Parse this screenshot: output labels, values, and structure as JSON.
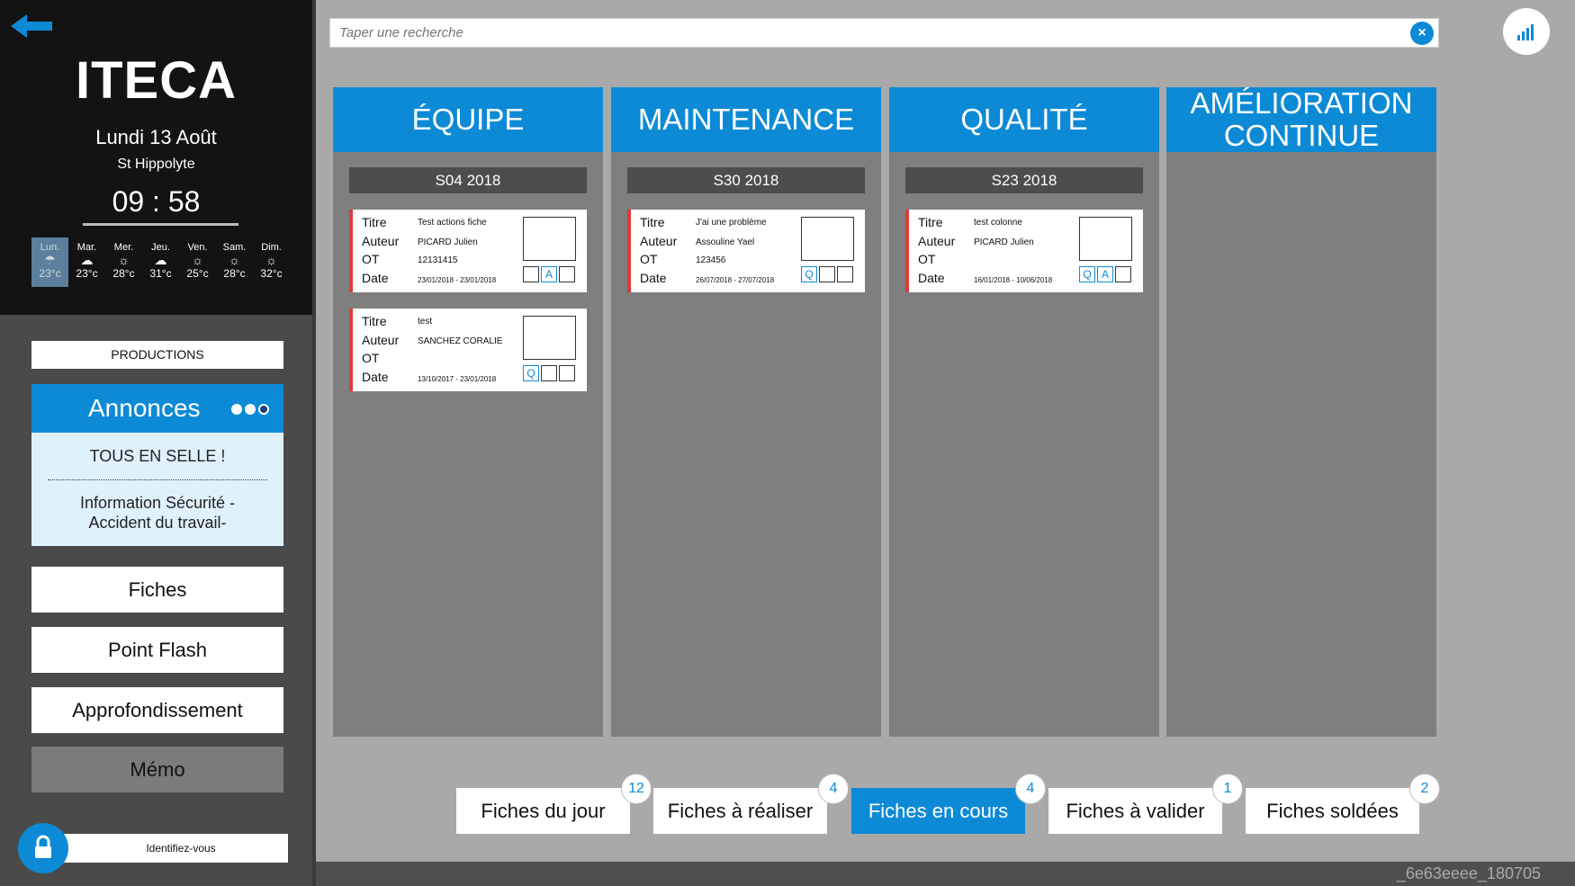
{
  "sidebar": {
    "logo": "ITECA",
    "date": "Lundi 13 Août",
    "location": "St Hippolyte",
    "clock": "09 : 58",
    "weather": [
      {
        "day": "Lun.",
        "icon": "rain-icon",
        "glyph": "☂",
        "temp": "23°c"
      },
      {
        "day": "Mar.",
        "icon": "cloud-icon",
        "glyph": "☁",
        "temp": "23°c"
      },
      {
        "day": "Mer.",
        "icon": "sun-icon",
        "glyph": "☼",
        "temp": "28°c"
      },
      {
        "day": "Jeu.",
        "icon": "cloud-icon",
        "glyph": "☁",
        "temp": "31°c"
      },
      {
        "day": "Ven.",
        "icon": "sun-icon",
        "glyph": "☼",
        "temp": "25°c"
      },
      {
        "day": "Sam.",
        "icon": "sun-icon",
        "glyph": "☼",
        "temp": "28°c"
      },
      {
        "day": "Dim.",
        "icon": "sun-icon",
        "glyph": "☼",
        "temp": "32°c"
      }
    ],
    "productions_label": "PRODUCTIONS",
    "annonces": {
      "title": "Annonces",
      "items": [
        "TOUS EN SELLE !",
        "Information Sécurité - Accident du travail-"
      ]
    },
    "buttons": {
      "fiches": "Fiches",
      "point_flash": "Point Flash",
      "approfondissement": "Approfondissement",
      "memo": "Mémo"
    },
    "login_placeholder": "Identifiez-vous"
  },
  "search": {
    "placeholder": "Taper une recherche"
  },
  "columns": [
    {
      "title": "ÉQUIPE",
      "week": "S04 2018",
      "cards": [
        {
          "titre": "Test actions fiche",
          "auteur": "PICARD Julien",
          "ot": "12131415",
          "date": "23/01/2018 - 23/01/2018",
          "boxes": [
            "",
            "A",
            ""
          ]
        },
        {
          "titre": "test",
          "auteur": "SANCHEZ CORALIE",
          "ot": "",
          "date": "13/10/2017 - 23/01/2018",
          "boxes": [
            "Q",
            "",
            ""
          ]
        }
      ]
    },
    {
      "title": "MAINTENANCE",
      "week": "S30 2018",
      "cards": [
        {
          "titre": "J'ai une problème",
          "auteur": "Assouline Yael",
          "ot": "123456",
          "date": "26/07/2018 - 27/07/2018",
          "boxes": [
            "Q",
            "",
            ""
          ]
        }
      ]
    },
    {
      "title": "QUALITÉ",
      "week": "S23 2018",
      "cards": [
        {
          "titre": "test colonne",
          "auteur": "PICARD Julien",
          "ot": "",
          "date": "16/01/2018 - 10/06/2018",
          "boxes": [
            "Q",
            "A",
            ""
          ]
        }
      ]
    },
    {
      "title_line1": "AMÉLIORATION",
      "title_line2": "CONTINUE"
    }
  ],
  "card_labels": {
    "titre": "Titre",
    "auteur": "Auteur",
    "ot": "OT",
    "date": "Date"
  },
  "tabs": [
    {
      "label": "Fiches du jour",
      "count": "12"
    },
    {
      "label": "Fiches à réaliser",
      "count": "4"
    },
    {
      "label": "Fiches en cours",
      "count": "4"
    },
    {
      "label": "Fiches à valider",
      "count": "1"
    },
    {
      "label": "Fiches soldées",
      "count": "2"
    }
  ],
  "build_id": "_6e63eeee_180705",
  "colors": {
    "accent": "#0d8ad6",
    "card_border": "#e03a3a",
    "sidebar_dark": "#131313"
  }
}
